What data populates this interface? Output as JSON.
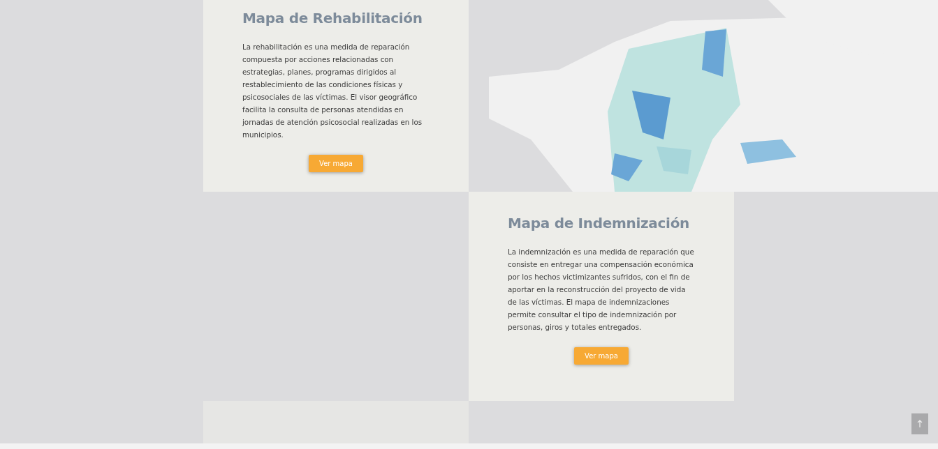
{
  "sections": [
    {
      "kind": "map-card",
      "title": "Mapa de Rehabilitación",
      "text": "La rehabilitación es una medida de reparación compuesta por acciones relacionadas con estrategias, planes, programas dirigidos al restablecimiento de las condiciones físicas y psicosociales de las víctimas. El visor geográfico facilita la consulta de personas atendidas en jornadas de atención psicosocial realizadas en los municipios.",
      "button": "Ver mapa"
    },
    {
      "kind": "map-card",
      "title": "Mapa de Indemnización",
      "text": "La indemnización es una medida de reparación que consiste en entregar una compensación económica por los hechos victimizantes sufridos, con el fin de aportar en la reconstrucción del proyecto de vida de las víctimas. El mapa de indemnizaciones permite consultar el tipo de indemnización por personas, giros y totales entregados.",
      "button": "Ver mapa"
    },
    {
      "kind": "picture"
    }
  ]
}
